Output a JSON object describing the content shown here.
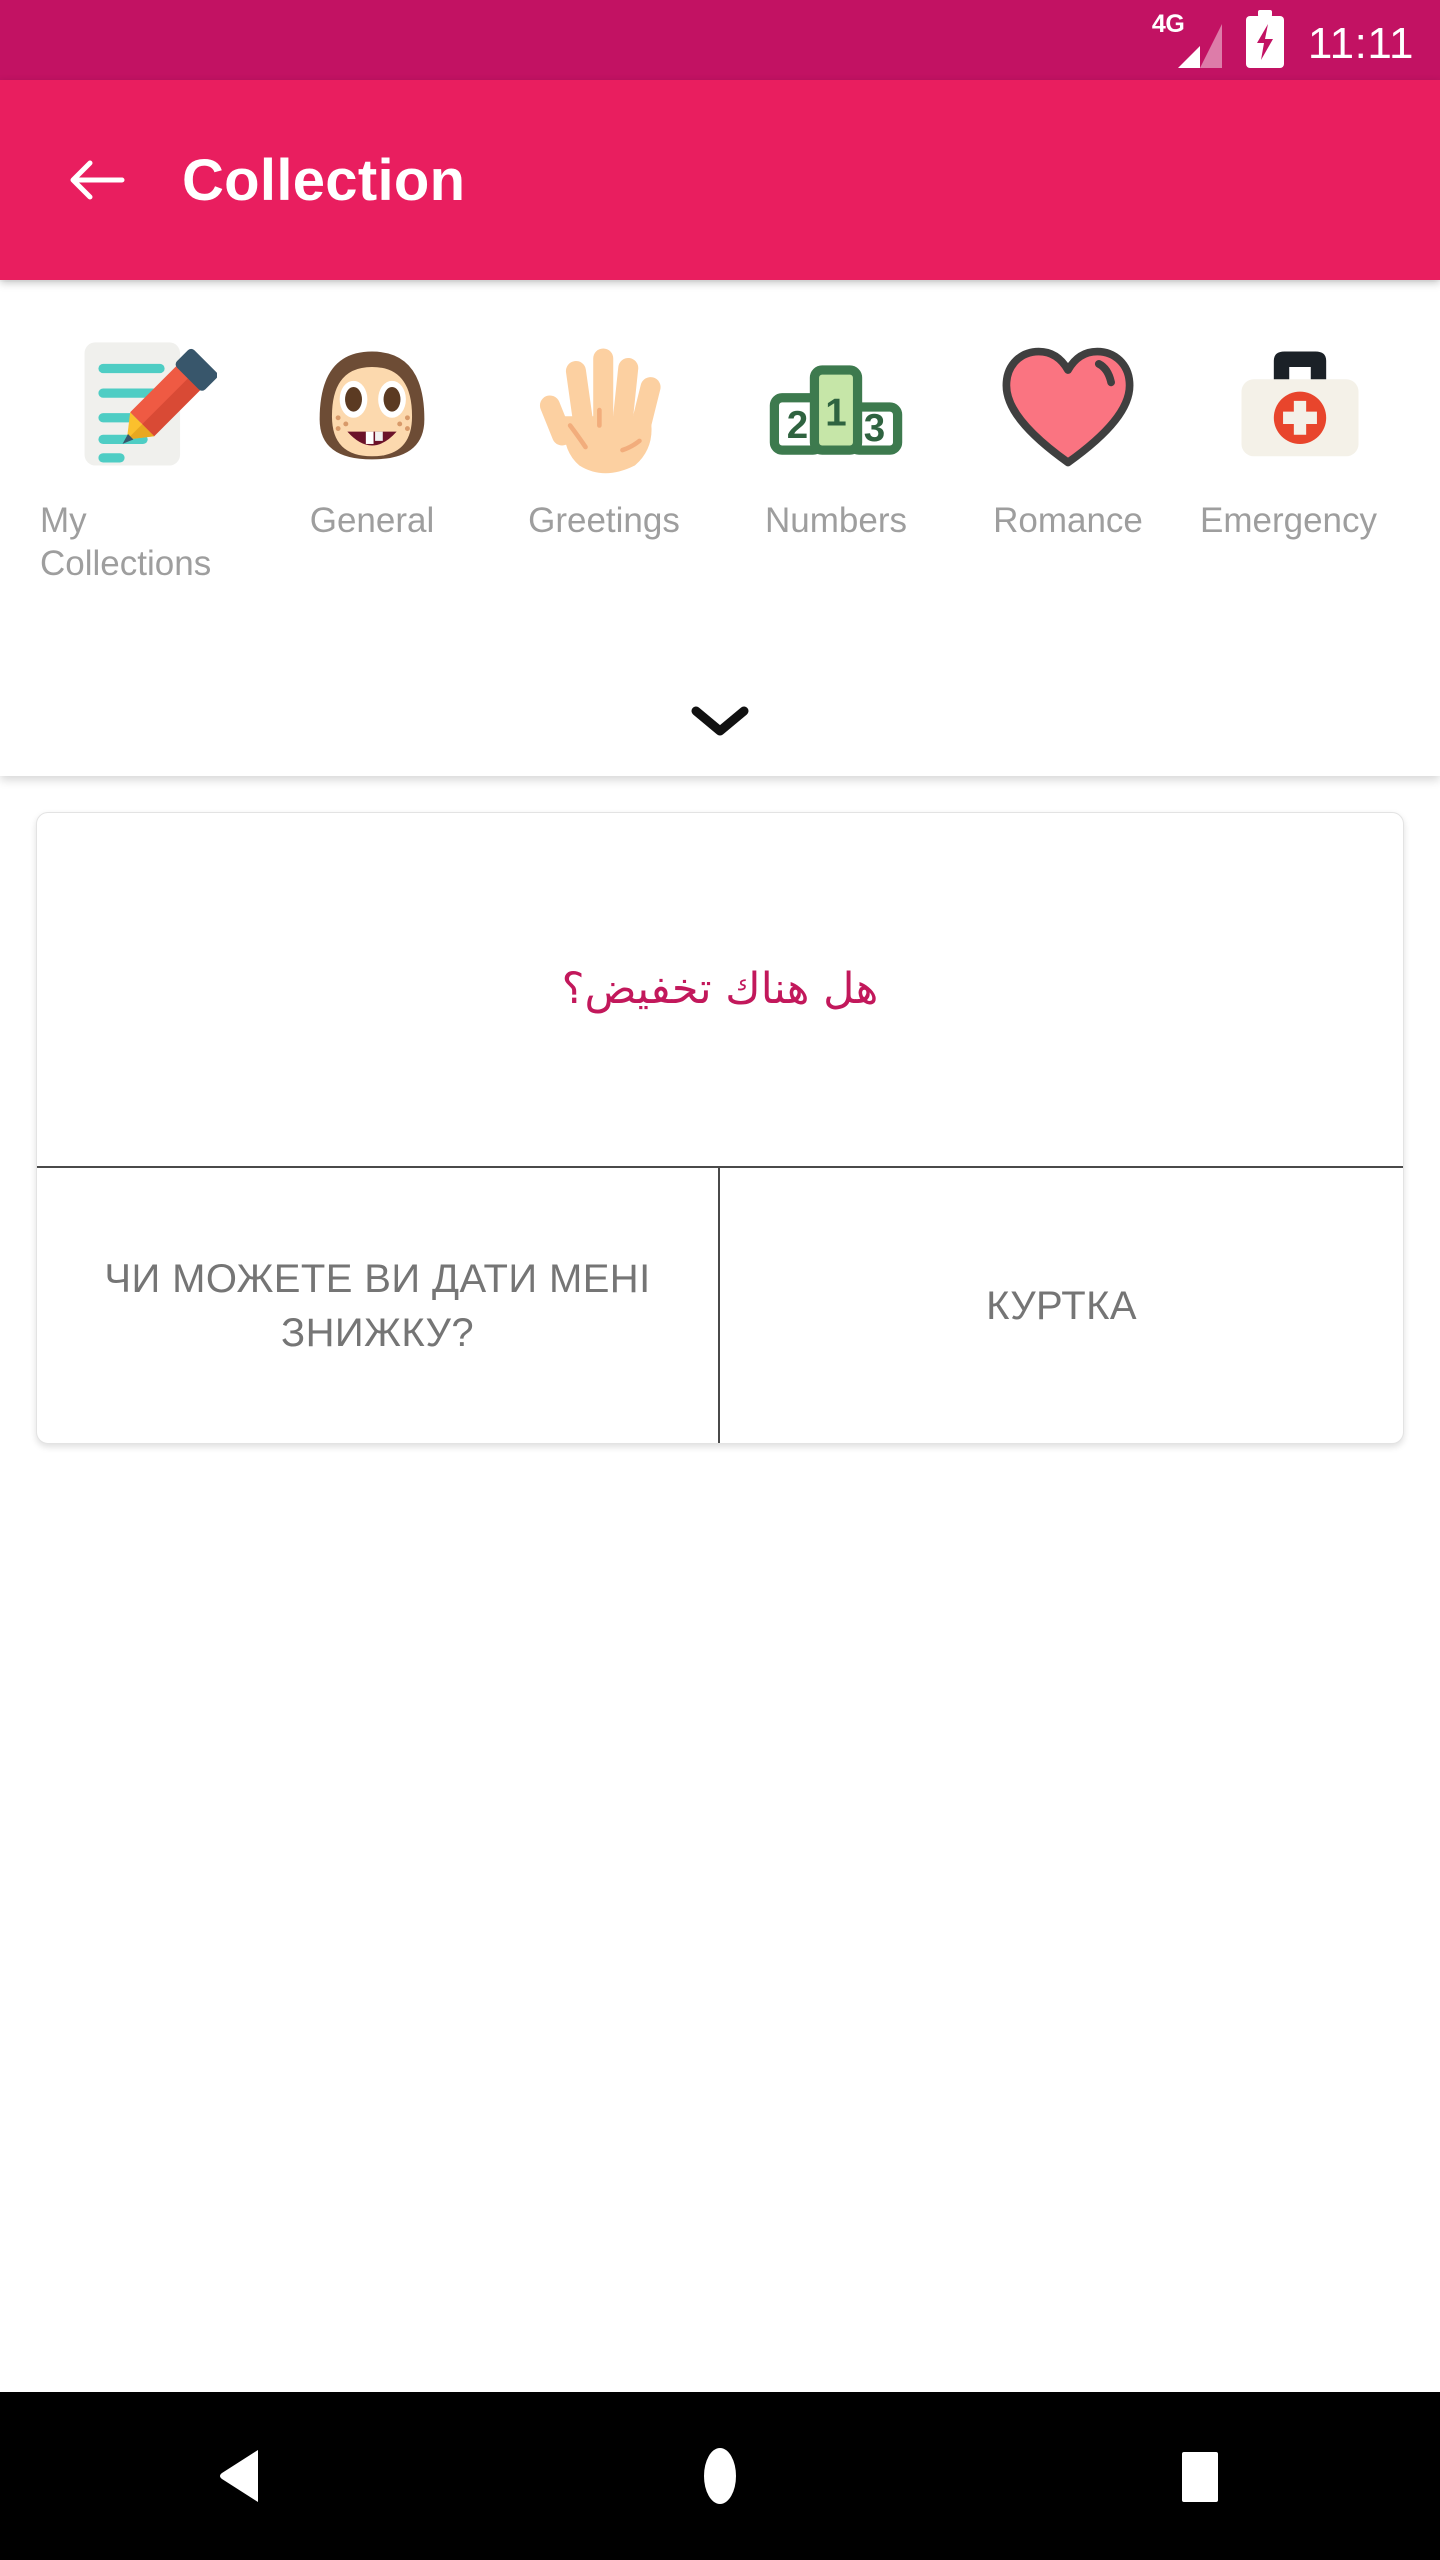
{
  "status_bar": {
    "network_label": "4G",
    "signal_icon": "signal-bars-icon",
    "battery_icon": "battery-charging-icon",
    "time": "11:11",
    "background_color": "#C21263"
  },
  "app_bar": {
    "back_icon": "back-arrow-icon",
    "title": "Collection",
    "background_color": "#E91E5F"
  },
  "categories": {
    "expand_icon": "chevron-down-icon",
    "items": [
      {
        "label": "My Collections",
        "icon": "memo-pencil-icon",
        "wrap": true
      },
      {
        "label": "General",
        "icon": "girl-face-icon",
        "wrap": false
      },
      {
        "label": "Greetings",
        "icon": "raised-hand-icon",
        "wrap": false
      },
      {
        "label": "Numbers",
        "icon": "podium-123-icon",
        "wrap": false
      },
      {
        "label": "Romance",
        "icon": "heart-icon",
        "wrap": false
      },
      {
        "label": "Emergency",
        "icon": "first-aid-kit-icon",
        "wrap": true
      }
    ]
  },
  "phrase_card": {
    "source_text": "هل هناك تخفيض؟",
    "source_color": "#C2185B",
    "translation_left": "ЧИ МОЖЕТЕ ВИ ДАТИ МЕНІ ЗНИЖКУ?",
    "translation_right": "КУРТКА",
    "translation_color": "#757575"
  },
  "nav_bar": {
    "back_icon": "nav-back-triangle-icon",
    "home_icon": "nav-home-circle-icon",
    "recents_icon": "nav-recents-square-icon"
  }
}
